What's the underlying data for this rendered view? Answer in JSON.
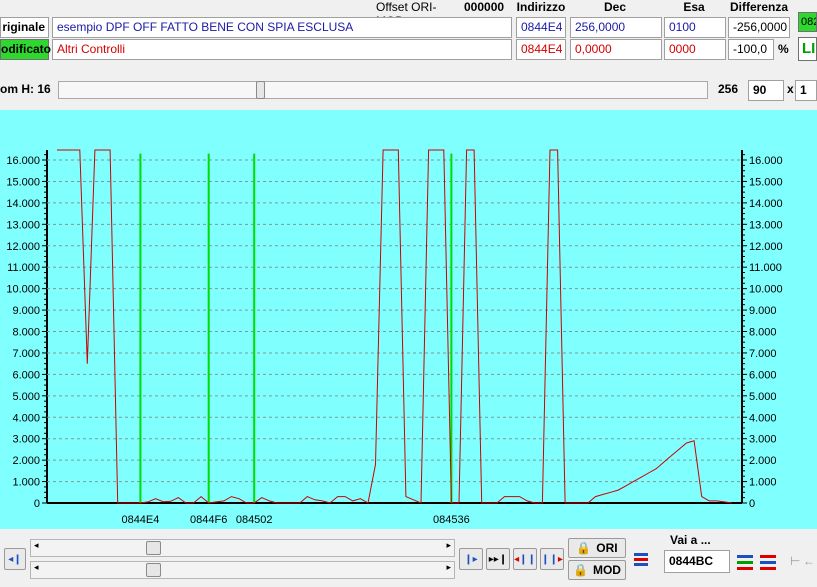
{
  "header": {
    "offset_label": "Offset ORI-MOD",
    "offset_value": "000000",
    "col_indirizzo": "Indirizzo",
    "col_dec": "Dec",
    "col_esa": "Esa",
    "col_differenza": "Differenza"
  },
  "rows": {
    "original": {
      "label": "riginale",
      "description": "esempio DPF OFF FATTO BENE CON SPIA ESCLUSA",
      "indirizzo": "0844E4",
      "dec": "256,0000",
      "esa": "0100",
      "differenza": "-256,0000"
    },
    "modified": {
      "label": "odificato",
      "description": "Altri Controlli",
      "indirizzo": "0844E4",
      "dec": "0,0000",
      "esa": "0000",
      "differenza": "-100,0",
      "percent": "%"
    }
  },
  "right_edge": {
    "badge_top": "082",
    "badge_bottom": "LI"
  },
  "zoom": {
    "label": "om H: 16",
    "value": "256",
    "field_a": "90",
    "x_label": "x",
    "field_b": "1"
  },
  "bottom": {
    "ori_label": "ORI",
    "mod_label": "MOD",
    "vai_label": "Vai a ...",
    "vai_value": "0844BC"
  },
  "colors": {
    "chart_bg": "#80ffff",
    "line": "#cc0000",
    "marker": "#00dd00",
    "original_badge": "#00dd00"
  },
  "chart_data": {
    "type": "line",
    "ylim": [
      0,
      16500
    ],
    "y_ticks": [
      "0",
      "1.000",
      "2.000",
      "3.000",
      "4.000",
      "5.000",
      "6.000",
      "7.000",
      "8.000",
      "9.000",
      "10.000",
      "11.000",
      "12.000",
      "13.000",
      "14.000",
      "15.000",
      "16.000"
    ],
    "y_tick_values": [
      0,
      1000,
      2000,
      3000,
      4000,
      5000,
      6000,
      7000,
      8000,
      9000,
      10000,
      11000,
      12000,
      13000,
      14000,
      15000,
      16000
    ],
    "x_count": 90,
    "x_marker_labels": [
      {
        "label": "0844E4",
        "index": 11
      },
      {
        "label": "0844F6",
        "index": 20
      },
      {
        "label": "084502",
        "index": 26
      },
      {
        "label": "084536",
        "index": 52
      }
    ],
    "grid": true,
    "series": [
      {
        "values": [
          16500,
          16500,
          16500,
          16500,
          6500,
          16500,
          16500,
          16500,
          0,
          0,
          0,
          0,
          50,
          200,
          60,
          80,
          250,
          0,
          0,
          300,
          0,
          50,
          100,
          300,
          200,
          0,
          0,
          250,
          100,
          0,
          0,
          0,
          0,
          300,
          150,
          100,
          0,
          300,
          300,
          100,
          200,
          0,
          1800,
          16500,
          16500,
          16500,
          300,
          150,
          0,
          16500,
          16500,
          16500,
          0,
          0,
          16500,
          16500,
          0,
          0,
          0,
          300,
          300,
          300,
          100,
          0,
          0,
          16500,
          16500,
          0,
          0,
          0,
          0,
          300,
          400,
          500,
          600,
          800,
          1000,
          1200,
          1400,
          1600,
          1900,
          2200,
          2500,
          2800,
          2900,
          300,
          100,
          100,
          50,
          0
        ]
      }
    ]
  }
}
